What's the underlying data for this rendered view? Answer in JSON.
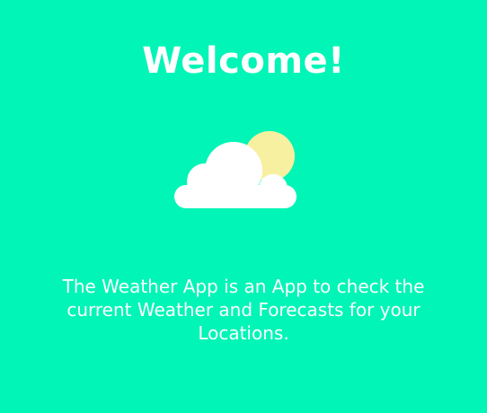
{
  "welcome": {
    "title": "Welcome!",
    "illustration_icon": "cloud-sun-icon",
    "description": "The Weather App is an App to check the current Weather and Forecasts for your Locations."
  },
  "colors": {
    "background": "#00F5B7",
    "text": "#FFFFFF",
    "sun": "#F7F0A0",
    "cloud": "#FFFFFF"
  }
}
